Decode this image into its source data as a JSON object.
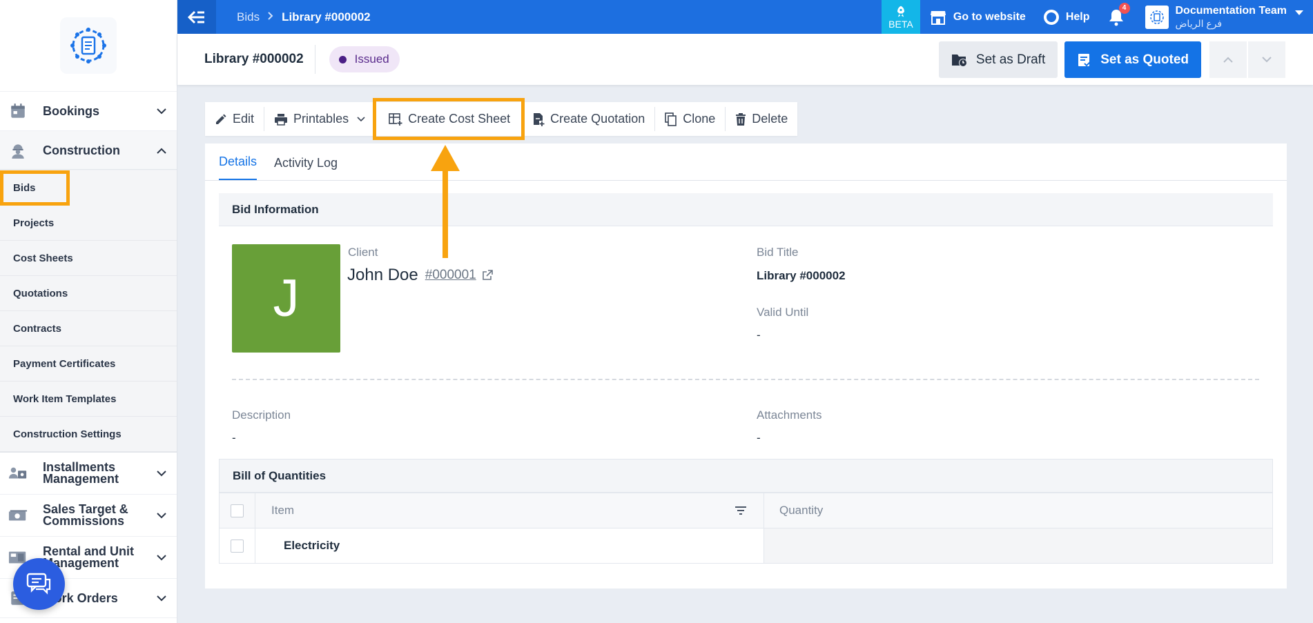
{
  "sidebar": {
    "items": [
      {
        "label": "Bookings",
        "icon": "calendar-icon"
      },
      {
        "label": "Construction",
        "icon": "worker-icon",
        "expanded": true,
        "children": [
          "Bids",
          "Projects",
          "Cost Sheets",
          "Quotations",
          "Contracts",
          "Payment Certificates",
          "Work Item Templates",
          "Construction Settings"
        ]
      },
      {
        "label": "Installments Management",
        "icon": "users-money-icon"
      },
      {
        "label": "Sales Target & Commissions",
        "icon": "cash-icon"
      },
      {
        "label": "Rental and Unit Management",
        "icon": "units-icon"
      },
      {
        "label": "Work Orders",
        "icon": "work-order-icon"
      }
    ],
    "active_child": "Bids"
  },
  "topbar": {
    "breadcrumb": [
      "Bids",
      "Library #000002"
    ],
    "beta_label": "BETA",
    "go_to_website": "Go to website",
    "help": "Help",
    "notification_count": "4",
    "account_name": "Documentation Team",
    "account_branch": "فرع الرياض"
  },
  "header": {
    "title": "Library #000002",
    "status": "Issued",
    "set_as_draft": "Set as Draft",
    "set_as_quoted": "Set as Quoted"
  },
  "toolbar": {
    "edit": "Edit",
    "printables": "Printables",
    "create_cost_sheet": "Create Cost Sheet",
    "create_quotation": "Create Quotation",
    "clone": "Clone",
    "delete": "Delete"
  },
  "tabs": [
    "Details",
    "Activity Log"
  ],
  "bid_info": {
    "section_title": "Bid Information",
    "avatar_letter": "J",
    "client_label": "Client",
    "client_name": "John Doe",
    "client_id": "#000001",
    "bid_title_label": "Bid Title",
    "bid_title": "Library #000002",
    "valid_until_label": "Valid Until",
    "valid_until": "-",
    "description_label": "Description",
    "description": "-",
    "attachments_label": "Attachments",
    "attachments": "-"
  },
  "boq": {
    "section_title": "Bill of Quantities",
    "columns": [
      "Item",
      "Quantity"
    ],
    "rows": [
      {
        "item": "Electricity",
        "quantity": ""
      }
    ]
  },
  "colors": {
    "primary": "#1d6fe0",
    "highlight": "#f8a30f",
    "status_bg": "#f0e6f7",
    "avatar_bg": "#689f38"
  }
}
